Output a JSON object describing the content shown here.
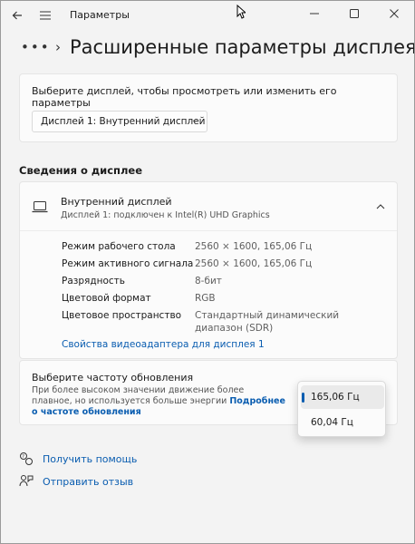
{
  "window": {
    "title": "Параметры",
    "controls": [
      "minimize",
      "maximize",
      "close"
    ]
  },
  "header": {
    "breadcrumb_more": "•••",
    "title": "Расширенные параметры дисплея"
  },
  "display_picker": {
    "hint": "Выберите дисплей, чтобы просмотреть или изменить его параметры",
    "selected": "Дисплей 1: Внутренний дисплей"
  },
  "info_section": {
    "title": "Сведения о дисплее",
    "device_name": "Внутренний дисплей",
    "device_sub": "Дисплей 1: подключен к Intel(R) UHD Graphics",
    "properties": [
      {
        "key": "Режим рабочего стола",
        "value": "2560 × 1600, 165,06 Гц"
      },
      {
        "key": "Режим активного сигнала",
        "value": "2560 × 1600, 165,06 Гц"
      },
      {
        "key": "Разрядность",
        "value": "8-бит"
      },
      {
        "key": "Цветовой формат",
        "value": "RGB"
      },
      {
        "key": "Цветовое пространство",
        "value": "Стандартный динамический диапазон (SDR)"
      }
    ],
    "adapter_link": "Свойства видеоадаптера для дисплея 1"
  },
  "refresh_rate": {
    "title": "Выберите частоту обновления",
    "desc": "При более высоком значении движение более плавное, но используется больше энергии",
    "link": "Подробнее о частоте обновления",
    "options": [
      "165,06 Гц",
      "60,04 Гц"
    ],
    "selected": "165,06 Гц"
  },
  "footer": {
    "help": "Получить помощь",
    "feedback": "Отправить отзыв"
  },
  "colors": {
    "accent": "#0a5db0",
    "background": "#f3f3f3",
    "card": "#fbfbfb"
  }
}
